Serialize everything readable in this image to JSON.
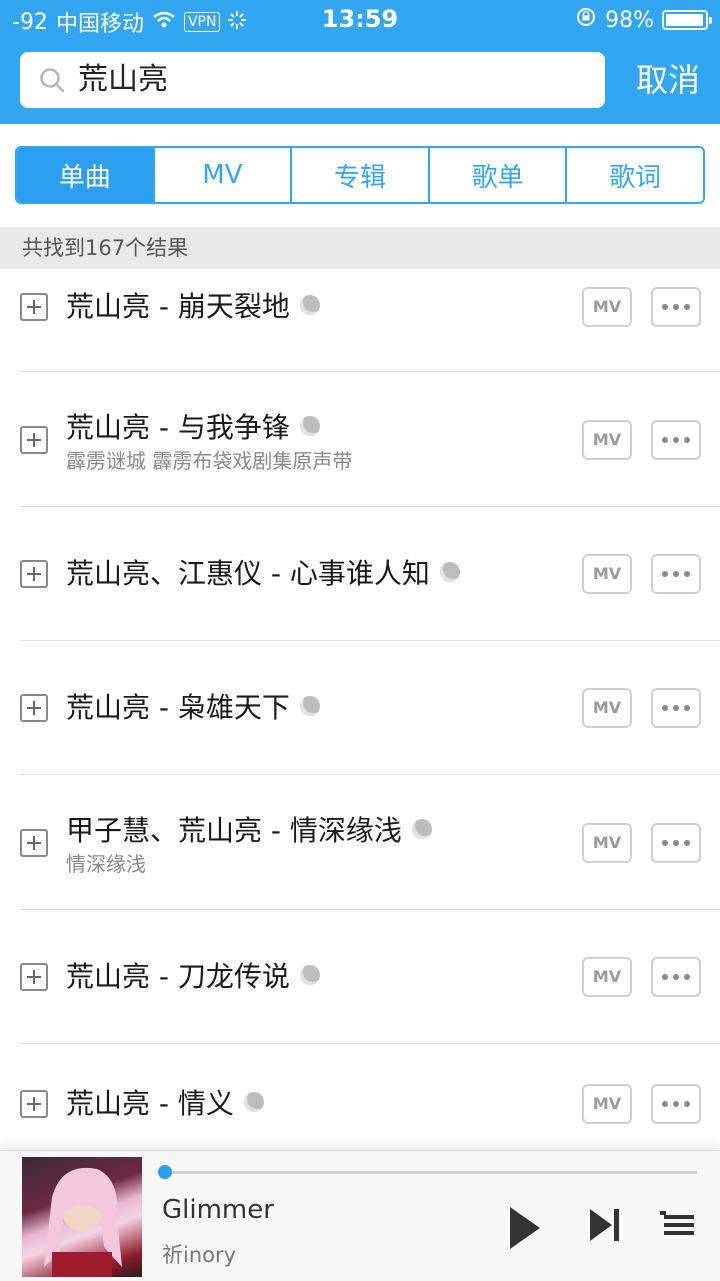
{
  "status_bar": {
    "signal": "-92",
    "carrier": "中国移动",
    "vpn": "VPN",
    "time": "13:59",
    "battery": "98%",
    "battery_level": 0.98
  },
  "search": {
    "query": "荒山亮",
    "cancel_label": "取消"
  },
  "tabs": [
    {
      "label": "单曲",
      "active": true
    },
    {
      "label": "MV",
      "active": false
    },
    {
      "label": "专辑",
      "active": false
    },
    {
      "label": "歌单",
      "active": false
    },
    {
      "label": "歌词",
      "active": false
    }
  ],
  "result_count": "共找到167个结果",
  "songs": [
    {
      "title": "荒山亮 - 崩天裂地",
      "subtitle": ""
    },
    {
      "title": "荒山亮 - 与我争锋",
      "subtitle": "霹雳谜城 霹雳布袋戏剧集原声带"
    },
    {
      "title": "荒山亮、江惠仪 - 心事谁人知",
      "subtitle": ""
    },
    {
      "title": "荒山亮 - 枭雄天下",
      "subtitle": ""
    },
    {
      "title": "甲子慧、荒山亮 - 情深缘浅",
      "subtitle": "情深缘浅"
    },
    {
      "title": "荒山亮 - 刀龙传说",
      "subtitle": ""
    },
    {
      "title": "荒山亮 - 情义",
      "subtitle": ""
    }
  ],
  "mv_label": "MV",
  "player": {
    "title": "Glimmer",
    "artist": "祈inory",
    "progress": 0.0
  },
  "colors": {
    "accent": "#33a6f2",
    "tab_active": "#2b9ef0"
  }
}
